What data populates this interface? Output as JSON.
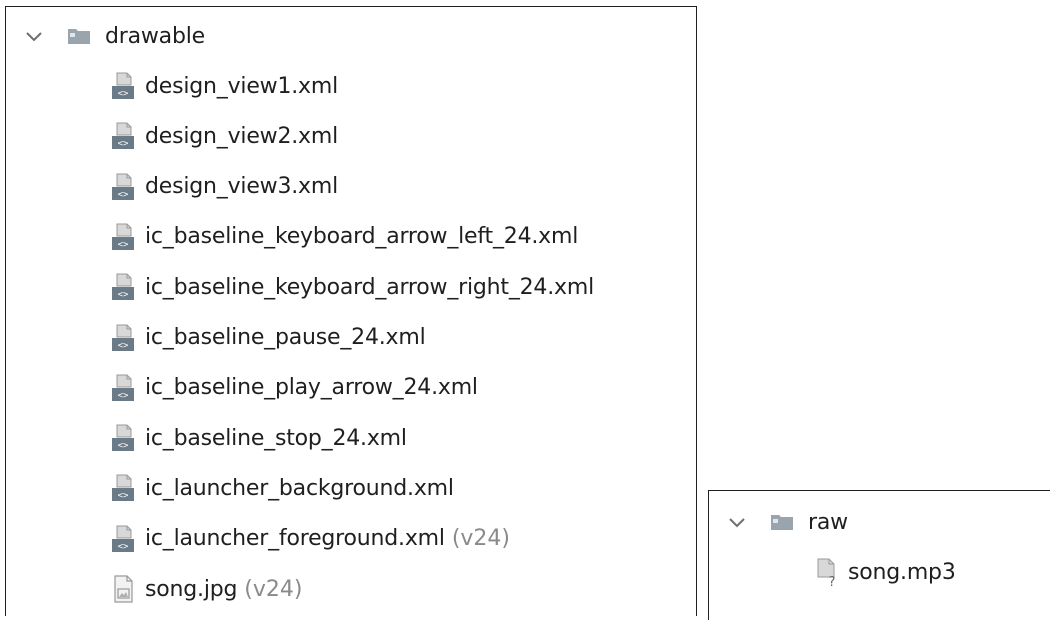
{
  "left_tree": {
    "folder_label": "drawable",
    "files": [
      {
        "name": "design_view1.xml",
        "suffix": "",
        "icon": "xml-file-icon"
      },
      {
        "name": "design_view2.xml",
        "suffix": "",
        "icon": "xml-file-icon"
      },
      {
        "name": "design_view3.xml",
        "suffix": "",
        "icon": "xml-file-icon"
      },
      {
        "name": "ic_baseline_keyboard_arrow_left_24.xml",
        "suffix": "",
        "icon": "xml-file-icon"
      },
      {
        "name": "ic_baseline_keyboard_arrow_right_24.xml",
        "suffix": "",
        "icon": "xml-file-icon"
      },
      {
        "name": "ic_baseline_pause_24.xml",
        "suffix": "",
        "icon": "xml-file-icon"
      },
      {
        "name": "ic_baseline_play_arrow_24.xml",
        "suffix": "",
        "icon": "xml-file-icon"
      },
      {
        "name": "ic_baseline_stop_24.xml",
        "suffix": "",
        "icon": "xml-file-icon"
      },
      {
        "name": "ic_launcher_background.xml",
        "suffix": "",
        "icon": "xml-file-icon"
      },
      {
        "name": "ic_launcher_foreground.xml",
        "suffix": "(v24)",
        "icon": "xml-file-icon"
      },
      {
        "name": "song.jpg",
        "suffix": "(v24)",
        "icon": "image-file-icon"
      }
    ]
  },
  "right_tree": {
    "folder_label": "raw",
    "files": [
      {
        "name": "song.mp3",
        "suffix": "",
        "icon": "unknown-file-icon"
      }
    ]
  },
  "colors": {
    "folder": "#9aa4ad",
    "chevron": "#6e6e6e",
    "suffix": "#8a8a8a",
    "border": "#202020"
  }
}
